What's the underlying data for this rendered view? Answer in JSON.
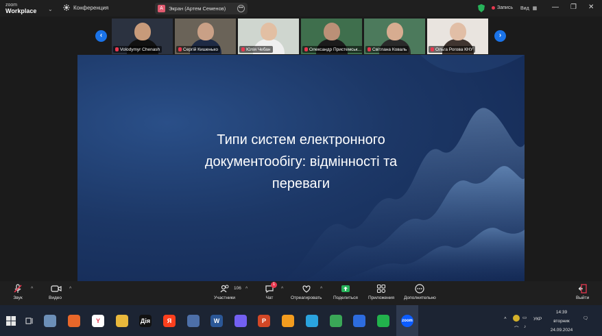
{
  "app": {
    "brand_top": "zoom",
    "brand_bottom": "Workplace",
    "meeting_label": "Конференция"
  },
  "share": {
    "avatar_letter": "A",
    "label": "Экран (Артем Семенов)"
  },
  "titlebar": {
    "record_label": "Запись",
    "view_label": "Вид"
  },
  "gallery": {
    "participants": [
      {
        "name": "Volodymyr Chenash",
        "bg": "#2b3240",
        "skin": "#c79a7a",
        "shirt": "#111"
      },
      {
        "name": "Сергій Кишенько",
        "bg": "#6a6358",
        "skin": "#c9a086",
        "shirt": "#1e2a44"
      },
      {
        "name": "Юлія Чебан",
        "bg": "#cfd6cf",
        "skin": "#e2bfa3",
        "shirt": "#efefef"
      },
      {
        "name": "Олександр Пристемськ...",
        "bg": "#3f6f4d",
        "skin": "#bb9077",
        "shirt": "#1b1b1b"
      },
      {
        "name": "Світлана Коваль",
        "bg": "#4c7a5c",
        "skin": "#d7ac90",
        "shirt": "#2a2a2a"
      },
      {
        "name": "Ольга Рогова КНУ",
        "bg": "#e9e4df",
        "skin": "#e1bea6",
        "shirt": "#403530"
      }
    ]
  },
  "slide": {
    "title": "Типи систем електронного\nдокументообігу: відмінності та\nпереваги"
  },
  "toolbar": {
    "audio": "Звук",
    "video": "Видео",
    "participants": "Участники",
    "participants_count": "106",
    "chat": "Чат",
    "chat_badge": "1",
    "react": "Отреагировать",
    "share": "Поделиться",
    "apps": "Приложения",
    "more": "Дополнительно",
    "leave": "Выйти"
  },
  "taskbar": {
    "apps": [
      {
        "name": "notepad-icon",
        "color": "#6c8fb8",
        "text": ""
      },
      {
        "name": "firefox-icon",
        "color": "#e8672a",
        "text": ""
      },
      {
        "name": "yandex-browser-icon",
        "color": "#ffffff",
        "text": "Y"
      },
      {
        "name": "file-explorer-icon",
        "color": "#e9b83c",
        "text": ""
      },
      {
        "name": "diia-icon",
        "color": "#111111",
        "text": "Дія"
      },
      {
        "name": "yandex-icon",
        "color": "#fc3f1d",
        "text": "Я"
      },
      {
        "name": "save-icon",
        "color": "#4d6fa8",
        "text": ""
      },
      {
        "name": "word-icon",
        "color": "#2b5797",
        "text": "W"
      },
      {
        "name": "viber-icon",
        "color": "#7360f2",
        "text": ""
      },
      {
        "name": "powerpoint-icon",
        "color": "#d24726",
        "text": "P"
      },
      {
        "name": "orange-app-icon",
        "color": "#f39c1f",
        "text": ""
      },
      {
        "name": "telegram-icon",
        "color": "#2aa3df",
        "text": ""
      },
      {
        "name": "chrome-icon",
        "color": "#3aa757",
        "text": ""
      },
      {
        "name": "dropbox-icon",
        "color": "#2d6cdf",
        "text": ""
      },
      {
        "name": "green-app-icon",
        "color": "#22b24c",
        "text": ""
      },
      {
        "name": "zoom-icon",
        "color": "#0b5cff",
        "text": "zoom"
      }
    ],
    "lang": "УКР",
    "time": "14:39",
    "weekday": "вторник",
    "date": "24.09.2024"
  }
}
